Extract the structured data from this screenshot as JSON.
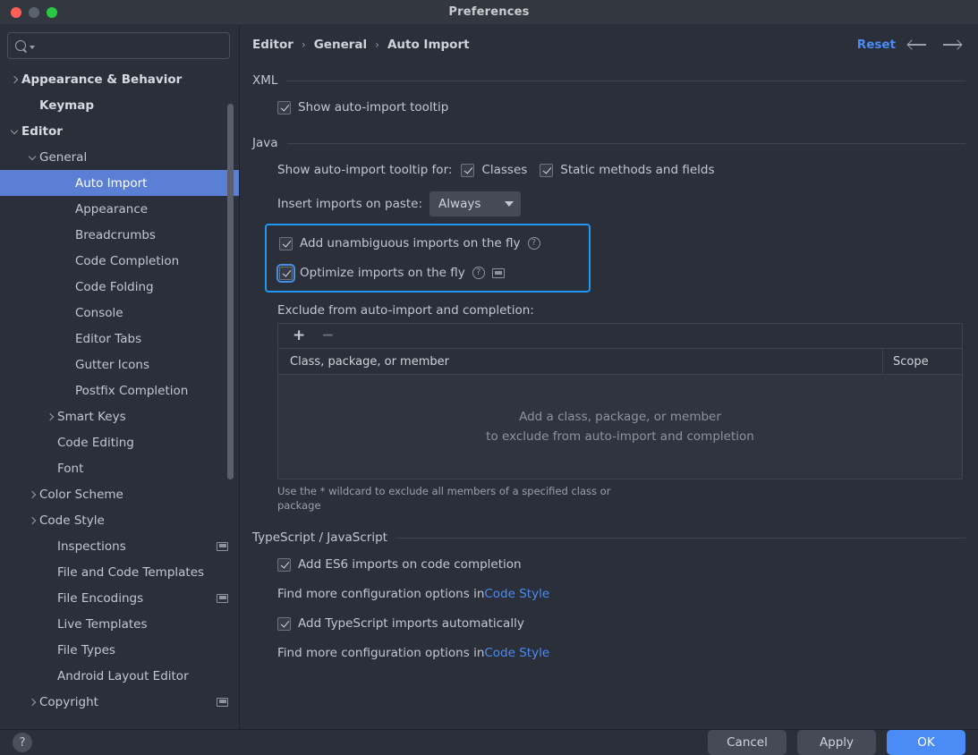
{
  "window": {
    "title": "Preferences",
    "traffic_lights": [
      "close-button",
      "minimize-button",
      "zoom-button"
    ]
  },
  "sidebar": {
    "search": {
      "value": "",
      "placeholder": ""
    },
    "items": [
      {
        "label": "Appearance & Behavior",
        "indent": 0,
        "twisty": "right",
        "bold": true,
        "selected": false,
        "badge": false
      },
      {
        "label": "Keymap",
        "indent": 1,
        "twisty": "none",
        "bold": true,
        "selected": false,
        "badge": false
      },
      {
        "label": "Editor",
        "indent": 0,
        "twisty": "down",
        "bold": true,
        "selected": false,
        "badge": false
      },
      {
        "label": "General",
        "indent": 1,
        "twisty": "down",
        "bold": false,
        "selected": false,
        "badge": false
      },
      {
        "label": "Auto Import",
        "indent": 3,
        "twisty": "none",
        "bold": false,
        "selected": true,
        "badge": false
      },
      {
        "label": "Appearance",
        "indent": 3,
        "twisty": "none",
        "bold": false,
        "selected": false,
        "badge": false
      },
      {
        "label": "Breadcrumbs",
        "indent": 3,
        "twisty": "none",
        "bold": false,
        "selected": false,
        "badge": false
      },
      {
        "label": "Code Completion",
        "indent": 3,
        "twisty": "none",
        "bold": false,
        "selected": false,
        "badge": false
      },
      {
        "label": "Code Folding",
        "indent": 3,
        "twisty": "none",
        "bold": false,
        "selected": false,
        "badge": false
      },
      {
        "label": "Console",
        "indent": 3,
        "twisty": "none",
        "bold": false,
        "selected": false,
        "badge": false
      },
      {
        "label": "Editor Tabs",
        "indent": 3,
        "twisty": "none",
        "bold": false,
        "selected": false,
        "badge": false
      },
      {
        "label": "Gutter Icons",
        "indent": 3,
        "twisty": "none",
        "bold": false,
        "selected": false,
        "badge": false
      },
      {
        "label": "Postfix Completion",
        "indent": 3,
        "twisty": "none",
        "bold": false,
        "selected": false,
        "badge": false
      },
      {
        "label": "Smart Keys",
        "indent": 2,
        "twisty": "right",
        "bold": false,
        "selected": false,
        "badge": false
      },
      {
        "label": "Code Editing",
        "indent": 2,
        "twisty": "none",
        "bold": false,
        "selected": false,
        "badge": false
      },
      {
        "label": "Font",
        "indent": 2,
        "twisty": "none",
        "bold": false,
        "selected": false,
        "badge": false
      },
      {
        "label": "Color Scheme",
        "indent": 1,
        "twisty": "right",
        "bold": false,
        "selected": false,
        "badge": false
      },
      {
        "label": "Code Style",
        "indent": 1,
        "twisty": "right",
        "bold": false,
        "selected": false,
        "badge": false
      },
      {
        "label": "Inspections",
        "indent": 2,
        "twisty": "none",
        "bold": false,
        "selected": false,
        "badge": true
      },
      {
        "label": "File and Code Templates",
        "indent": 2,
        "twisty": "none",
        "bold": false,
        "selected": false,
        "badge": false
      },
      {
        "label": "File Encodings",
        "indent": 2,
        "twisty": "none",
        "bold": false,
        "selected": false,
        "badge": true
      },
      {
        "label": "Live Templates",
        "indent": 2,
        "twisty": "none",
        "bold": false,
        "selected": false,
        "badge": false
      },
      {
        "label": "File Types",
        "indent": 2,
        "twisty": "none",
        "bold": false,
        "selected": false,
        "badge": false
      },
      {
        "label": "Android Layout Editor",
        "indent": 2,
        "twisty": "none",
        "bold": false,
        "selected": false,
        "badge": false
      },
      {
        "label": "Copyright",
        "indent": 1,
        "twisty": "right",
        "bold": false,
        "selected": false,
        "badge": true
      }
    ]
  },
  "header": {
    "breadcrumbs": [
      "Editor",
      "General",
      "Auto Import"
    ],
    "separator": "›",
    "reset_label": "Reset",
    "back_icon": "arrow-left-icon",
    "forward_icon": "arrow-right-icon"
  },
  "main": {
    "xml": {
      "title": "XML",
      "show_tooltip": {
        "label": "Show auto-import tooltip",
        "checked": true
      }
    },
    "java": {
      "title": "Java",
      "tooltip_for_label": "Show auto-import tooltip for:",
      "tooltip_classes": {
        "label": "Classes",
        "checked": true
      },
      "tooltip_static": {
        "label": "Static methods and fields",
        "checked": true
      },
      "insert_label": "Insert imports on paste:",
      "insert_value": "Always",
      "highlighted": {
        "add_unambiguous": {
          "label": "Add unambiguous imports on the fly",
          "checked": true,
          "focused": false,
          "help": "?"
        },
        "optimize": {
          "label": "Optimize imports on the fly",
          "checked": true,
          "focused": true,
          "help": "?"
        }
      },
      "exclude_label": "Exclude from auto-import and completion:",
      "toolbar": {
        "add": "+",
        "remove": "−"
      },
      "columns": [
        "Class, package, or member",
        "Scope"
      ],
      "empty_lines": [
        "Add a class, package, or member",
        "to exclude from auto-import and completion"
      ],
      "hint": "Use the * wildcard to exclude all members of a specified class or package"
    },
    "ts_js": {
      "title": "TypeScript / JavaScript",
      "es6": {
        "label": "Add ES6 imports on code completion",
        "checked": true
      },
      "find_more_1_prefix": "Find more configuration options in ",
      "find_more_1_link": "Code Style",
      "typescript": {
        "label": "Add TypeScript imports automatically",
        "checked": true
      },
      "find_more_2_prefix": "Find more configuration options in ",
      "find_more_2_link": "Code Style"
    }
  },
  "footer": {
    "help": "?",
    "cancel": "Cancel",
    "apply": "Apply",
    "ok": "OK"
  },
  "colors": {
    "accent_blue": "#4a8bf5",
    "selection_blue": "#5a7fd4",
    "highlight_border": "#2196f3",
    "background": "#2b2f3a",
    "text": "#c2c7d0"
  }
}
